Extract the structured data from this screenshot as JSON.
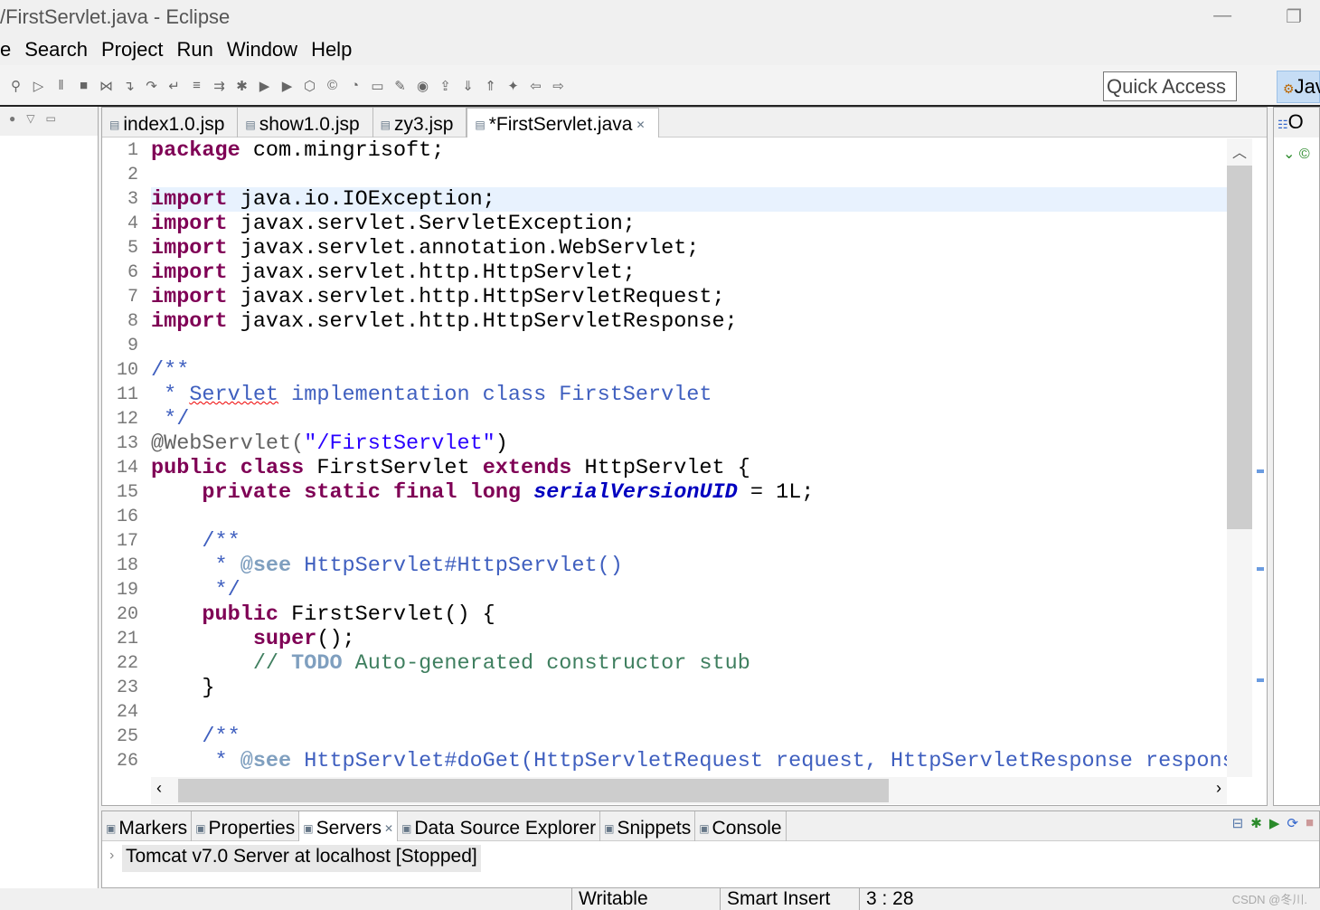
{
  "window": {
    "title": "/FirstServlet.java - Eclipse",
    "minimize": "—",
    "restore": "❐"
  },
  "menu": [
    "e",
    "Search",
    "Project",
    "Run",
    "Window",
    "Help"
  ],
  "toolbar": {
    "icons": [
      "pin-icon",
      "resume-icon",
      "suspend-icon",
      "terminate-icon",
      "disconnect-icon",
      "step-into-icon",
      "step-over-icon",
      "step-return-icon",
      "use-step-filters-icon",
      "drop-to-frame-icon",
      "debug-icon",
      "run-icon",
      "external-tools-icon",
      "new-server-icon",
      "new-java-class-icon",
      "open-type-icon",
      "open-task-icon",
      "search-icon",
      "web-browser-icon",
      "publish-icon",
      "next-annotation-icon",
      "prev-annotation-icon",
      "last-edit-icon",
      "back-icon",
      "forward-icon"
    ],
    "quick_access": "Quick Access",
    "perspective": "Jav"
  },
  "editor": {
    "tabs": [
      {
        "label": "index1.0.jsp"
      },
      {
        "label": "show1.0.jsp"
      },
      {
        "label": "zy3.jsp"
      },
      {
        "label": "*FirstServlet.java",
        "active": true
      }
    ],
    "current_line": 3,
    "cursor": "3 : 28",
    "lines": [
      [
        [
          "package",
          "kw"
        ],
        [
          " com.mingrisoft;",
          ""
        ]
      ],
      [],
      [
        [
          "import",
          "kw"
        ],
        [
          " java.io.IOException;",
          ""
        ]
      ],
      [
        [
          "import",
          "kw"
        ],
        [
          " javax.servlet.ServletException;",
          ""
        ]
      ],
      [
        [
          "import",
          "kw"
        ],
        [
          " javax.servlet.annotation.WebServlet;",
          ""
        ]
      ],
      [
        [
          "import",
          "kw"
        ],
        [
          " javax.servlet.http.HttpServlet;",
          ""
        ]
      ],
      [
        [
          "import",
          "kw"
        ],
        [
          " javax.servlet.http.HttpServletRequest;",
          ""
        ]
      ],
      [
        [
          "import",
          "kw"
        ],
        [
          " javax.servlet.http.HttpServletResponse;",
          ""
        ]
      ],
      [],
      [
        [
          "/**",
          "doc"
        ]
      ],
      [
        [
          " * ",
          "doc"
        ],
        [
          "Servlet",
          "doc spell"
        ],
        [
          " implementation class FirstServlet",
          "doc"
        ]
      ],
      [
        [
          " */",
          "doc"
        ]
      ],
      [
        [
          "@WebServlet(",
          "ann"
        ],
        [
          "\"/FirstServlet\"",
          "str"
        ],
        [
          ")",
          ""
        ]
      ],
      [
        [
          "public",
          "kw"
        ],
        [
          " ",
          ""
        ],
        [
          "class",
          "kw"
        ],
        [
          " FirstServlet ",
          ""
        ],
        [
          "extends",
          "kw"
        ],
        [
          " HttpServlet {",
          ""
        ]
      ],
      [
        [
          "    ",
          ""
        ],
        [
          "private",
          "kw"
        ],
        [
          " ",
          ""
        ],
        [
          "static",
          "kw"
        ],
        [
          " ",
          ""
        ],
        [
          "final",
          "kw"
        ],
        [
          " ",
          ""
        ],
        [
          "long",
          "kw"
        ],
        [
          " ",
          ""
        ],
        [
          "serialVersionUID",
          "fld"
        ],
        [
          " = 1L;",
          ""
        ]
      ],
      [],
      [
        [
          "    /**",
          "doc"
        ]
      ],
      [
        [
          "     * ",
          "doc"
        ],
        [
          "@see",
          "doctag"
        ],
        [
          " HttpServlet#HttpServlet()",
          "doc"
        ]
      ],
      [
        [
          "     */",
          "doc"
        ]
      ],
      [
        [
          "    ",
          ""
        ],
        [
          "public",
          "kw"
        ],
        [
          " FirstServlet() {",
          ""
        ]
      ],
      [
        [
          "        ",
          ""
        ],
        [
          "super",
          "kw"
        ],
        [
          "();",
          ""
        ]
      ],
      [
        [
          "        // ",
          "cm"
        ],
        [
          "TODO",
          "todo"
        ],
        [
          " Auto-generated constructor stub",
          "cm"
        ]
      ],
      [
        [
          "    }",
          ""
        ]
      ],
      [],
      [
        [
          "    /**",
          "doc"
        ]
      ],
      [
        [
          "     * ",
          "doc"
        ],
        [
          "@see",
          "doctag"
        ],
        [
          " HttpServlet#doGet(HttpServletRequest request, HttpServletResponse respons",
          "doc"
        ]
      ]
    ]
  },
  "bottom": {
    "tabs": [
      {
        "label": "Markers",
        "icon": "markers-icon"
      },
      {
        "label": "Properties",
        "icon": "properties-icon"
      },
      {
        "label": "Servers",
        "icon": "servers-icon",
        "active": true
      },
      {
        "label": "Data Source Explorer",
        "icon": "data-source-icon"
      },
      {
        "label": "Snippets",
        "icon": "snippets-icon"
      },
      {
        "label": "Console",
        "icon": "console-icon"
      }
    ],
    "server": "Tomcat v7.0 Server at localhost  [Stopped]"
  },
  "status": {
    "mode": "Writable",
    "insert": "Smart Insert",
    "position": "3 : 28"
  },
  "watermark": "CSDN @冬川.",
  "right_panel": {
    "label": "O"
  }
}
